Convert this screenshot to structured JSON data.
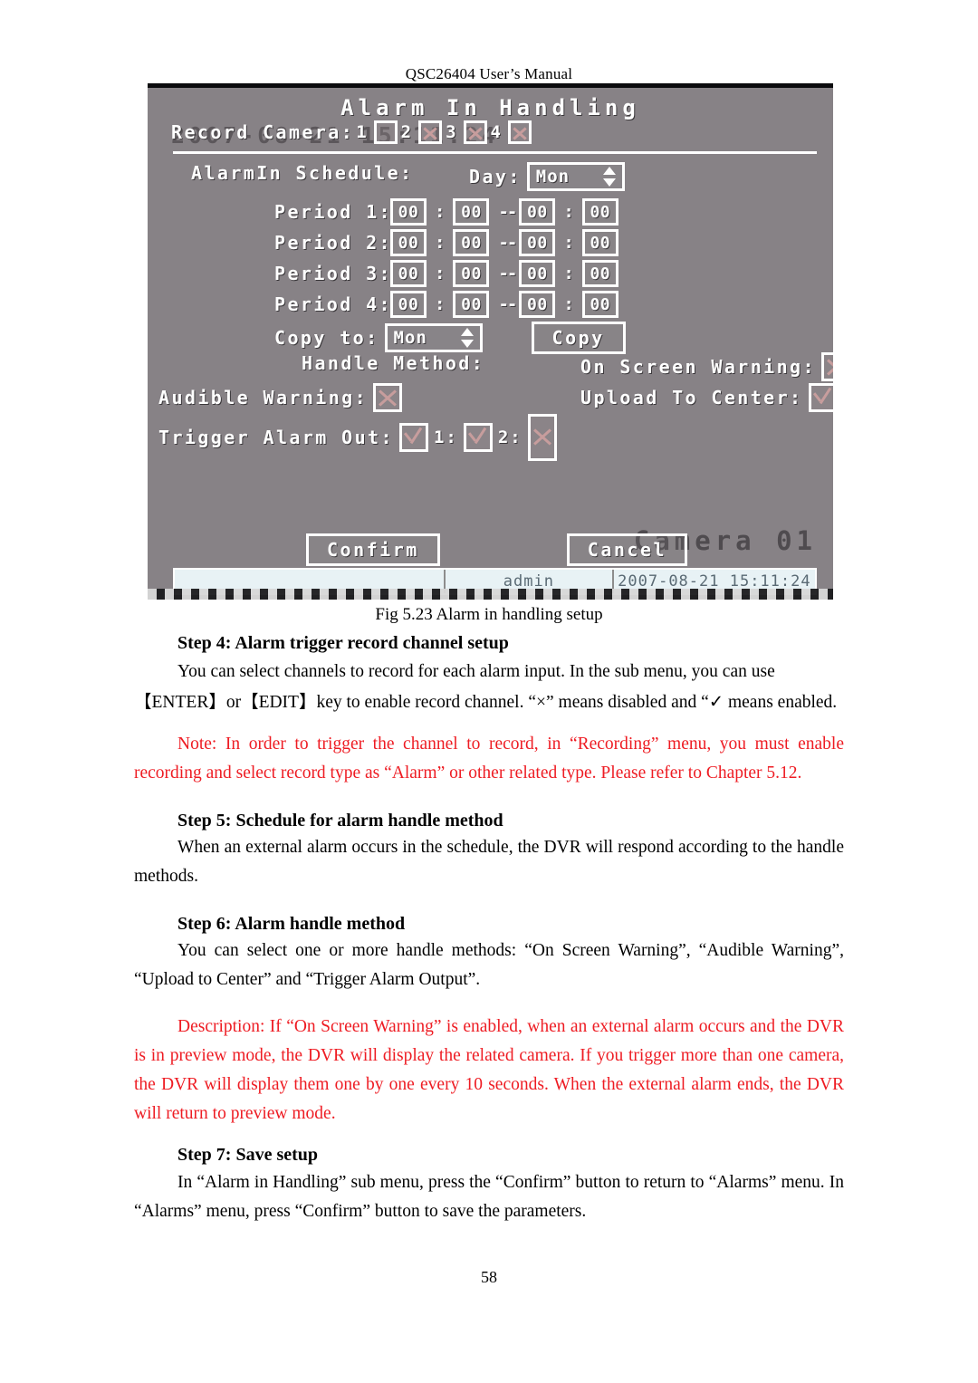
{
  "header": {
    "running_head": "QSC26404 User’s Manual",
    "page_number": "58"
  },
  "figure": {
    "caption": "Fig 5.23 Alarm in handling setup",
    "screen": {
      "title": "Alarm In Handling",
      "ghost_overlay_top": "2007-08-21 15:11:24",
      "ghost_overlay_camera": "Camera 01",
      "record_camera": {
        "label": "Record Camera:",
        "channels": [
          {
            "num": "1",
            "state": "blank"
          },
          {
            "num": "2",
            "state": "x"
          },
          {
            "num": "3",
            "state": "x"
          },
          {
            "num": "4",
            "state": "x"
          }
        ]
      },
      "alarmin_schedule_label": "AlarmIn Schedule:",
      "day_label": "Day:",
      "day_value": "Mon",
      "periods": [
        {
          "label": "Period 1:",
          "start_hour": "00",
          "start_min": "00",
          "end_hour": "00",
          "end_min": "00"
        },
        {
          "label": "Period 2:",
          "start_hour": "00",
          "start_min": "00",
          "end_hour": "00",
          "end_min": "00"
        },
        {
          "label": "Period 3:",
          "start_hour": "00",
          "start_min": "00",
          "end_hour": "00",
          "end_min": "00"
        },
        {
          "label": "Period 4:",
          "start_hour": "00",
          "start_min": "00",
          "end_hour": "00",
          "end_min": "00"
        }
      ],
      "time_separator": ":",
      "range_dash": "--",
      "copy_to_label": "Copy to:",
      "copy_to_value": "Mon",
      "copy_button": "Copy",
      "handle_method_label": "Handle Method:",
      "on_screen_warning_label": "On Screen Warning:",
      "on_screen_warning_state": "x",
      "audible_warning_label": "Audible Warning:",
      "audible_warning_state": "x",
      "upload_to_center_label": "Upload To Center:",
      "upload_to_center_state": "v",
      "trigger_alarm_out_label": "Trigger Alarm Out:",
      "trigger_alarm_out_state": "v",
      "alarm_out_1_label": "1:",
      "alarm_out_1_state": "v",
      "alarm_out_2_label": "2:",
      "alarm_out_2_state": "x",
      "confirm_button": "Confirm",
      "cancel_button": "Cancel",
      "statusbar": {
        "blank": "",
        "user": "admin",
        "datetime": "2007-08-21 15:11:24"
      }
    }
  },
  "content": {
    "step4_heading": "Step 4: Alarm trigger record channel setup",
    "step4_body": "You can select channels to record for each alarm input. In the sub menu, you can use",
    "step4_body2": "【ENTER】or【EDIT】key to enable record channel. “×” means disabled and “✓ means enabled.",
    "note": "Note: In order to trigger the channel to record, in “Recording” menu, you must enable recording and select record type as “Alarm” or other related type. Please refer to Chapter 5.12.",
    "step5_heading": "Step 5: Schedule for alarm handle method",
    "step5_body": "When an external alarm occurs in the schedule, the DVR will respond according to the handle methods.",
    "step6_heading": "Step 6: Alarm handle method",
    "step6_body": "You can select one or more handle methods: “On Screen Warning”, “Audible Warning”, “Upload to Center” and “Trigger Alarm Output”.",
    "description": "Description: If “On Screen Warning” is enabled, when an external alarm occurs and the DVR is in preview mode, the DVR will display the related camera. If you trigger more than one camera, the DVR will display them one by one every 10 seconds. When the external alarm ends, the DVR will return to preview mode.",
    "step7_heading": "Step 7: Save setup",
    "step7_body": "In “Alarm in Handling” sub menu, press the “Confirm” button to return to “Alarms” menu. In “Alarms” menu, press “Confirm” button to save the parameters."
  },
  "colors": {
    "screen_bg": "#878286",
    "note_red": "#ee1c23",
    "statusbar_bg": "#e8f2f5"
  }
}
